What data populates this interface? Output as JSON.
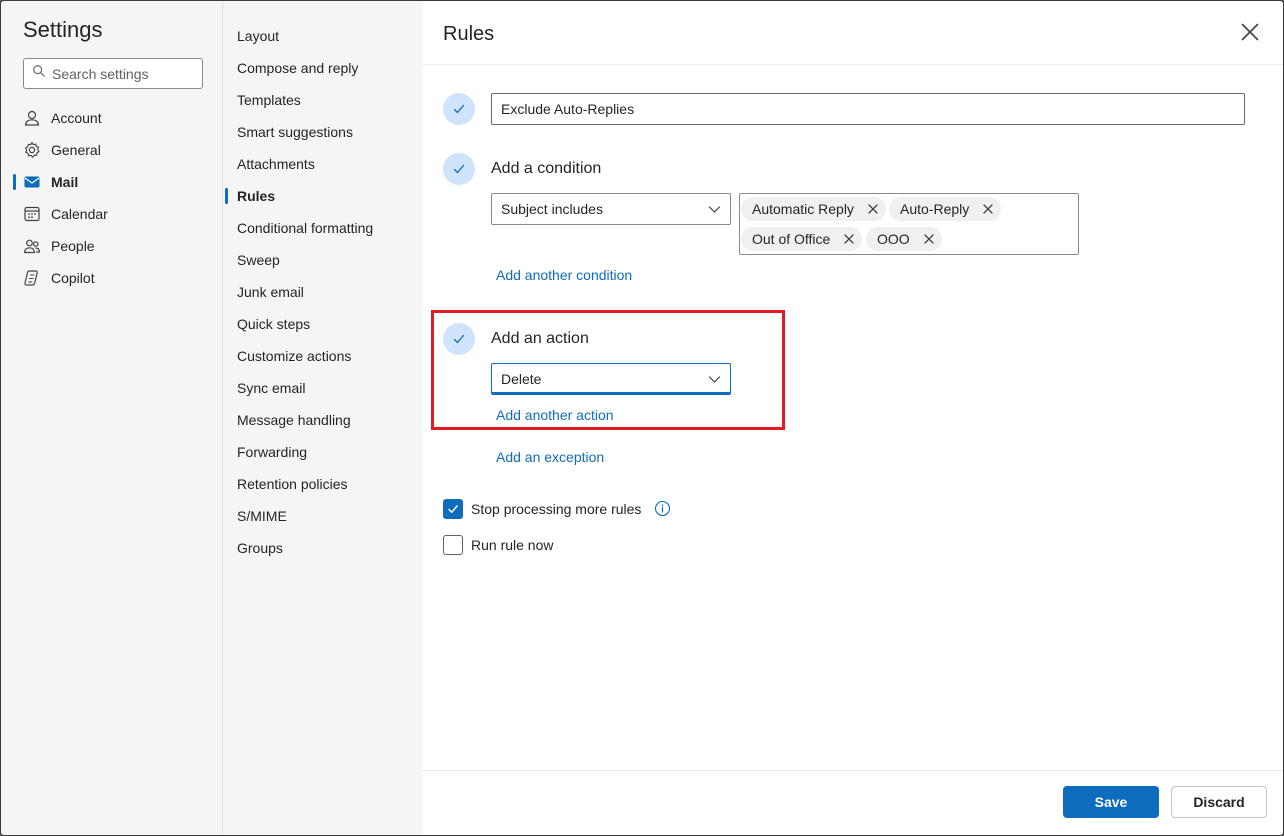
{
  "sidebar": {
    "title": "Settings",
    "search_placeholder": "Search settings",
    "items": [
      {
        "label": "Account",
        "icon": "person-icon"
      },
      {
        "label": "General",
        "icon": "gear-icon"
      },
      {
        "label": "Mail",
        "icon": "mail-icon",
        "active": true
      },
      {
        "label": "Calendar",
        "icon": "calendar-icon"
      },
      {
        "label": "People",
        "icon": "people-icon"
      },
      {
        "label": "Copilot",
        "icon": "copilot-icon"
      }
    ]
  },
  "subnav": {
    "items": [
      "Layout",
      "Compose and reply",
      "Templates",
      "Smart suggestions",
      "Attachments",
      "Rules",
      "Conditional formatting",
      "Sweep",
      "Junk email",
      "Quick steps",
      "Customize actions",
      "Sync email",
      "Message handling",
      "Forwarding",
      "Retention policies",
      "S/MIME",
      "Groups"
    ],
    "active": "Rules"
  },
  "main": {
    "title": "Rules",
    "rule_name": "Exclude Auto-Replies",
    "condition": {
      "label": "Add a condition",
      "selected": "Subject includes",
      "tags": [
        "Automatic Reply",
        "Auto-Reply",
        "Out of Office",
        "OOO"
      ],
      "add_link": "Add another condition"
    },
    "action": {
      "label": "Add an action",
      "selected": "Delete",
      "add_link": "Add another action"
    },
    "exception_link": "Add an exception",
    "stop_processing": {
      "label": "Stop processing more rules",
      "checked": true
    },
    "run_now": {
      "label": "Run rule now",
      "checked": false
    },
    "save_label": "Save",
    "discard_label": "Discard"
  },
  "colors": {
    "accent": "#0f6cbd",
    "highlight": "#e01b24",
    "step_circle": "#cfe4fa"
  }
}
